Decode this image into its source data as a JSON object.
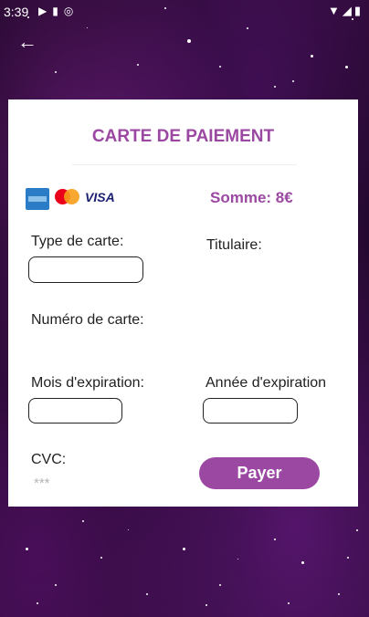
{
  "status_bar": {
    "time": "3:39",
    "left_icons": [
      "play-icon",
      "sd-card-icon",
      "data-saver-icon"
    ],
    "right_icons": [
      "wifi-icon",
      "signal-icon",
      "battery-icon"
    ]
  },
  "nav": {
    "back_icon": "arrow-left-icon"
  },
  "card": {
    "title": "CARTE DE PAIEMENT",
    "brands": {
      "visa_text": "VISA",
      "mastercard_text": "mastercard",
      "amex_text": "AMERICAN EXPRESS"
    },
    "amount": "Somme: 8€",
    "fields": {
      "card_type_label": "Type de carte:",
      "card_type_value": "",
      "holder_label": "Titulaire:",
      "card_number_label": "Numéro de carte:",
      "exp_month_label": "Mois d'expiration:",
      "exp_month_value": "",
      "exp_year_label": "Année d'expiration",
      "exp_year_value": "",
      "cvc_label": "CVC:",
      "cvc_placeholder": "***"
    },
    "pay_button": "Payer"
  },
  "colors": {
    "accent": "#9b48a3",
    "card_bg": "#ffffff"
  }
}
